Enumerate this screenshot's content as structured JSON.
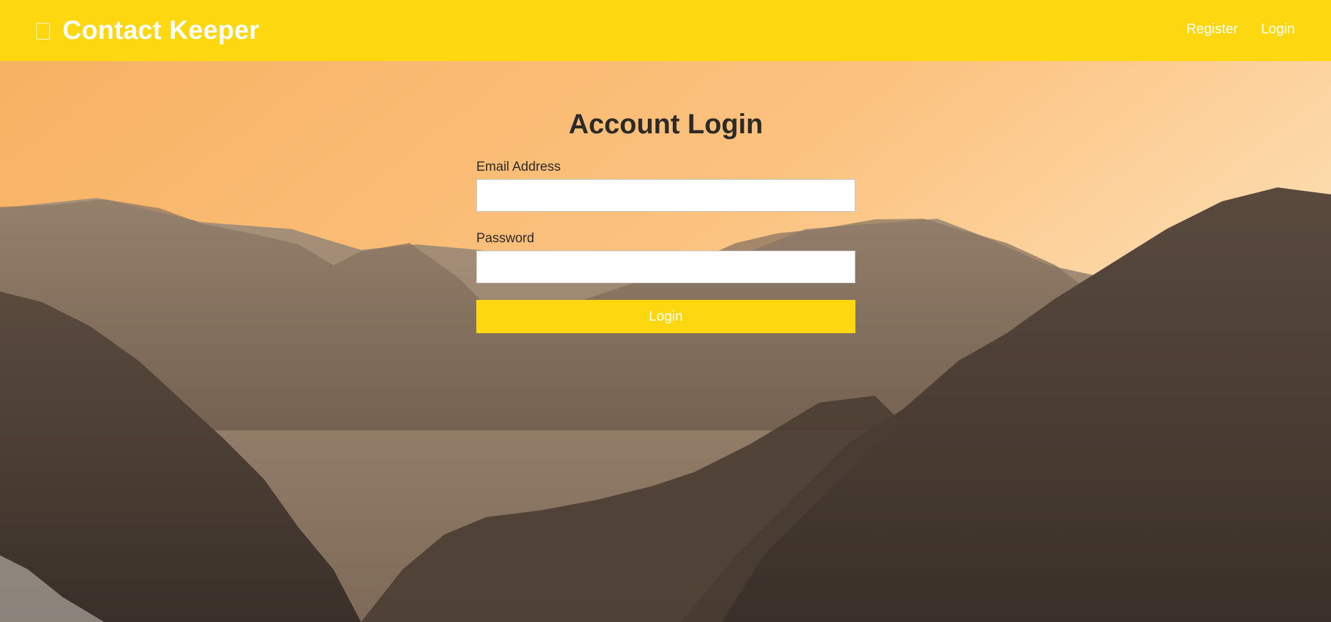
{
  "navbar": {
    "brand_icon": "id-card-icon",
    "brand_title": "Contact Keeper",
    "links": [
      {
        "label": "Register"
      },
      {
        "label": "Login"
      }
    ]
  },
  "login_form": {
    "title": "Account Login",
    "email": {
      "label": "Email Address",
      "value": "",
      "placeholder": ""
    },
    "password": {
      "label": "Password",
      "value": "",
      "placeholder": ""
    },
    "submit_label": "Login"
  },
  "colors": {
    "accent": "#fdd811",
    "text_dark": "#2c2a27",
    "sky_orange": "#f8b66a"
  }
}
